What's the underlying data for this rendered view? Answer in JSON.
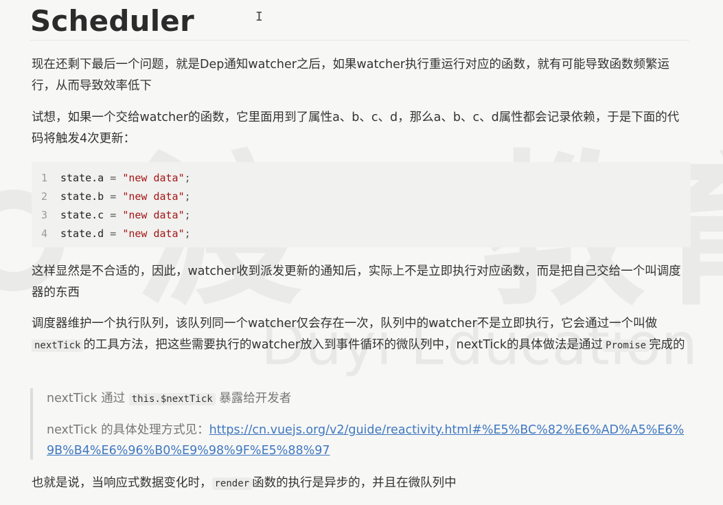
{
  "heading": "Scheduler",
  "cursor_glyph": "I",
  "paragraphs": {
    "p1": "现在还剩下最后一个问题，就是Dep通知watcher之后，如果watcher执行重运行对应的函数，就有可能导致函数频繁运行，从而导致效率低下",
    "p2": "试想，如果一个交给watcher的函数，它里面用到了属性a、b、c、d，那么a、b、c、d属性都会记录依赖，于是下面的代码将触发4次更新：",
    "p3": "这样显然是不合适的，因此，watcher收到派发更新的通知后，实际上不是立即执行对应函数，而是把自己交给一个叫调度器的东西",
    "p4_a": "调度器维护一个执行队列，该队列同一个watcher仅会存在一次，队列中的watcher不是立即执行，它会通过一个叫做",
    "p4_code1": "nextTick",
    "p4_b": "的工具方法，把这些需要执行的watcher放入到事件循环的微队列中，nextTick的具体做法是通过",
    "p4_code2": "Promise",
    "p4_c": "完成的",
    "p5_a": "也就是说，当响应式数据变化时，",
    "p5_code": "render",
    "p5_b": "函数的执行是异步的，并且在微队列中"
  },
  "code_block": {
    "lines": [
      {
        "num": "1",
        "obj": "state.a",
        "op": " = ",
        "str": "\"new data\"",
        "end": ";"
      },
      {
        "num": "2",
        "obj": "state.b",
        "op": " = ",
        "str": "\"new data\"",
        "end": ";"
      },
      {
        "num": "3",
        "obj": "state.c",
        "op": " = ",
        "str": "\"new data\"",
        "end": ";"
      },
      {
        "num": "4",
        "obj": "state.d",
        "op": " = ",
        "str": "\"new data\"",
        "end": ";"
      }
    ]
  },
  "blockquote": {
    "q1_a": "nextTick 通过",
    "q1_code": "this.$nextTick",
    "q1_b": "暴露给开发者",
    "q2_a": "nextTick 的具体处理方式见：",
    "q2_link": "https://cn.vuejs.org/v2/guide/reactivity.html#%E5%BC%82%E6%AD%A5%E6%9B%B4%E6%96%B0%E9%98%9F%E5%88%97"
  },
  "watermark": {
    "main": "渡一教育",
    "sub": "Duyi Education"
  },
  "colors": {
    "link": "#4078c0",
    "string": "#a31515",
    "quote_text": "#777777"
  }
}
